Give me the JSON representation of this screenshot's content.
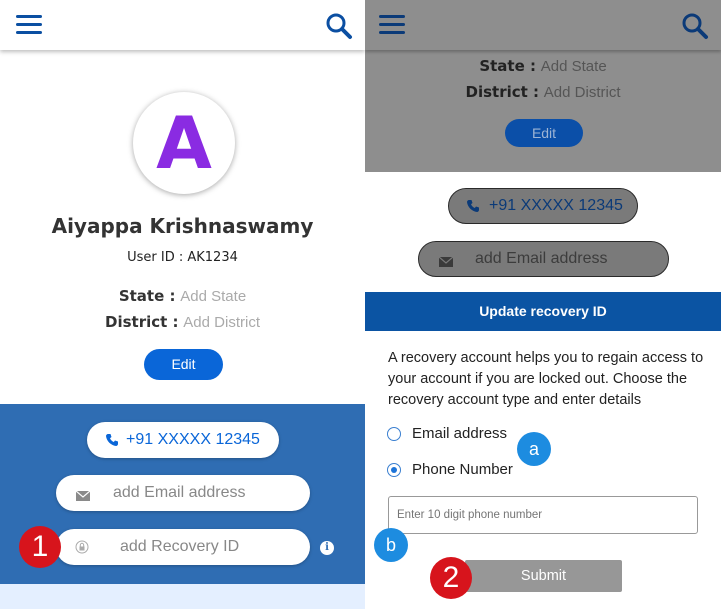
{
  "profile": {
    "avatar_letter": "A",
    "name": "Aiyappa Krishnaswamy",
    "user_id": "User ID : AK1234",
    "state_label": "State :",
    "state_value": "Add State",
    "district_label": "District :",
    "district_value": "Add District",
    "edit_label": "Edit"
  },
  "contact": {
    "phone": "+91 XXXXX 12345",
    "email_placeholder": "add Email address",
    "recovery_placeholder": "add Recovery ID"
  },
  "modal": {
    "title": "Update recovery ID",
    "description": "A recovery account helps you to regain access to your account if you are locked out. Choose the recovery account type and enter details",
    "options": [
      {
        "label": "Email address",
        "selected": false
      },
      {
        "label": "Phone Number",
        "selected": true
      }
    ],
    "input_placeholder": "Enter 10 digit phone number",
    "submit_label": "Submit"
  },
  "annotations": {
    "step1": "1",
    "step2": "2",
    "stepa": "a",
    "stepb": "b"
  },
  "icons": {
    "menu": "hamburger-icon",
    "search": "search-icon",
    "phone": "phone-icon",
    "email": "envelope-icon",
    "recovery": "lock-icon",
    "info": "info-icon"
  },
  "colors": {
    "brand_blue": "#0b4fa2",
    "accent_blue": "#0a66d8",
    "annotation_red": "#d7141c",
    "annotation_blue": "#1d8ce0",
    "avatar_purple": "#8a2be2"
  }
}
